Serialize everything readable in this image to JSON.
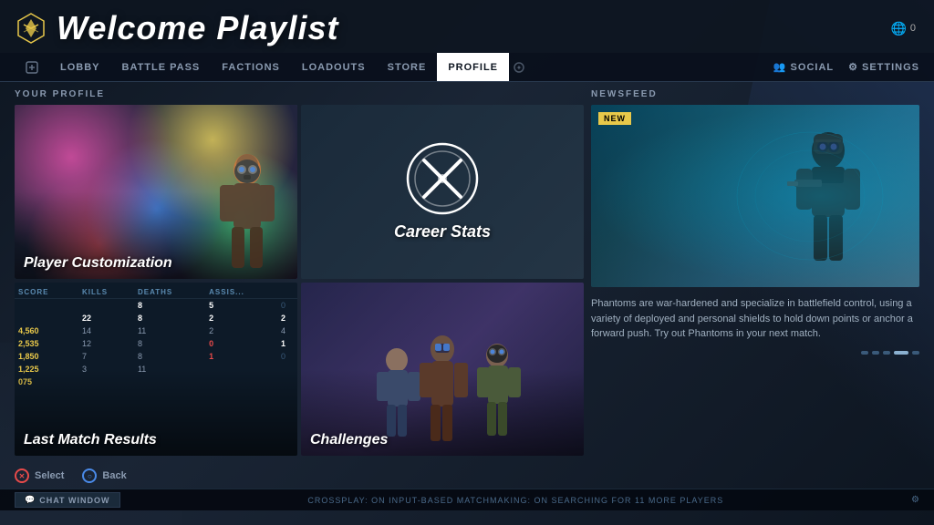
{
  "header": {
    "logo_alt": "game-logo",
    "title": "Welcome Playlist",
    "currency_icon": "🌐",
    "currency_amount": "0"
  },
  "nav": {
    "items": [
      {
        "id": "lobby",
        "label": "LOBBY",
        "active": false
      },
      {
        "id": "battle-pass",
        "label": "BATTLE PASS",
        "active": false
      },
      {
        "id": "factions",
        "label": "FACTIONS",
        "active": false
      },
      {
        "id": "loadouts",
        "label": "LOADOUTS",
        "active": false
      },
      {
        "id": "store",
        "label": "STORE",
        "active": false
      },
      {
        "id": "profile",
        "label": "PROFILE",
        "active": true
      }
    ],
    "right_buttons": [
      {
        "id": "social",
        "label": "SOCIAL",
        "icon": "👥"
      },
      {
        "id": "settings",
        "label": "SETTINGS",
        "icon": "⚙"
      }
    ]
  },
  "profile_panel": {
    "header": "YOUR PROFILE",
    "tiles": [
      {
        "id": "customization",
        "label": "Player Customization"
      },
      {
        "id": "career",
        "label": "Career Stats"
      },
      {
        "id": "match",
        "label": "Last Match Results"
      },
      {
        "id": "challenges",
        "label": "Challenges"
      }
    ],
    "match_table": {
      "headers": [
        "SCORE",
        "KILLS",
        "DEATHS",
        "ASSISTS",
        ""
      ],
      "rows": [
        {
          "score": "",
          "kills": "",
          "deaths": "8",
          "assists": "5",
          "extra": "0"
        },
        {
          "score": "",
          "kills": "22",
          "deaths": "8",
          "assists": "2",
          "extra": "2"
        },
        {
          "score": "4,560",
          "kills": "14",
          "deaths": "11",
          "assists": "2",
          "extra": "4"
        },
        {
          "score": "2,535",
          "kills": "12",
          "deaths": "8",
          "assists": "0",
          "extra": "1"
        },
        {
          "score": "1,850",
          "kills": "7",
          "deaths": "8",
          "assists": "1",
          "extra": "0"
        },
        {
          "score": "1,225",
          "kills": "3",
          "deaths": "11",
          "assists": "",
          "extra": ""
        },
        {
          "score": "075",
          "kills": "",
          "deaths": "",
          "assists": "",
          "extra": ""
        }
      ]
    }
  },
  "newsfeed": {
    "header": "NEWSFEED",
    "badge": "NEW",
    "description": "Phantoms are war-hardened and specialize in battlefield control, using a variety of deployed and personal shields to hold down points or anchor a forward push. Try out Phantoms in your next match.",
    "dots": [
      {
        "active": false
      },
      {
        "active": false
      },
      {
        "active": false
      },
      {
        "active": true
      },
      {
        "active": false
      }
    ]
  },
  "bottom_controls": [
    {
      "id": "select",
      "label": "Select",
      "icon": "✕",
      "color": "#e84a4a"
    },
    {
      "id": "back",
      "label": "Back",
      "icon": "○",
      "color": "#4a8ae8"
    }
  ],
  "status_bar": {
    "chat_label": "Chat Window",
    "status_text": "CROSSPLAY: ON   INPUT-BASED MATCHMAKING: ON   SEARCHING FOR 11 MORE PLAYERS",
    "right_icon": "⚙"
  }
}
